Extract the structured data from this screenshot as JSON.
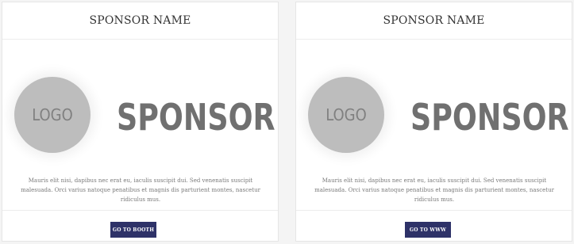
{
  "cards": [
    {
      "header": "SPONSOR NAME",
      "logo_text": "LOGO",
      "sponsor_text": "SPONSOR",
      "description": "Mauris elit nisi, dapibus nec erat eu, iaculis suscipit dui. Sed venenatis suscipit malesuada. Orci varius natoque penatibus et magnis dis parturient montes, nascetur ridiculus mus.",
      "button_label": "GO TO BOOTH"
    },
    {
      "header": "SPONSOR NAME",
      "logo_text": "LOGO",
      "sponsor_text": "SPONSOR",
      "description": "Mauris elit nisi, dapibus nec erat eu, iaculis suscipit dui. Sed venenatis suscipit malesuada. Orci varius natoque penatibus et magnis dis parturient montes, nascetur ridiculus mus.",
      "button_label": "GO TO WWW"
    }
  ],
  "colors": {
    "button": "#2e3268",
    "logo_circle": "#bdbdbd",
    "sponsor_text": "#707070"
  }
}
